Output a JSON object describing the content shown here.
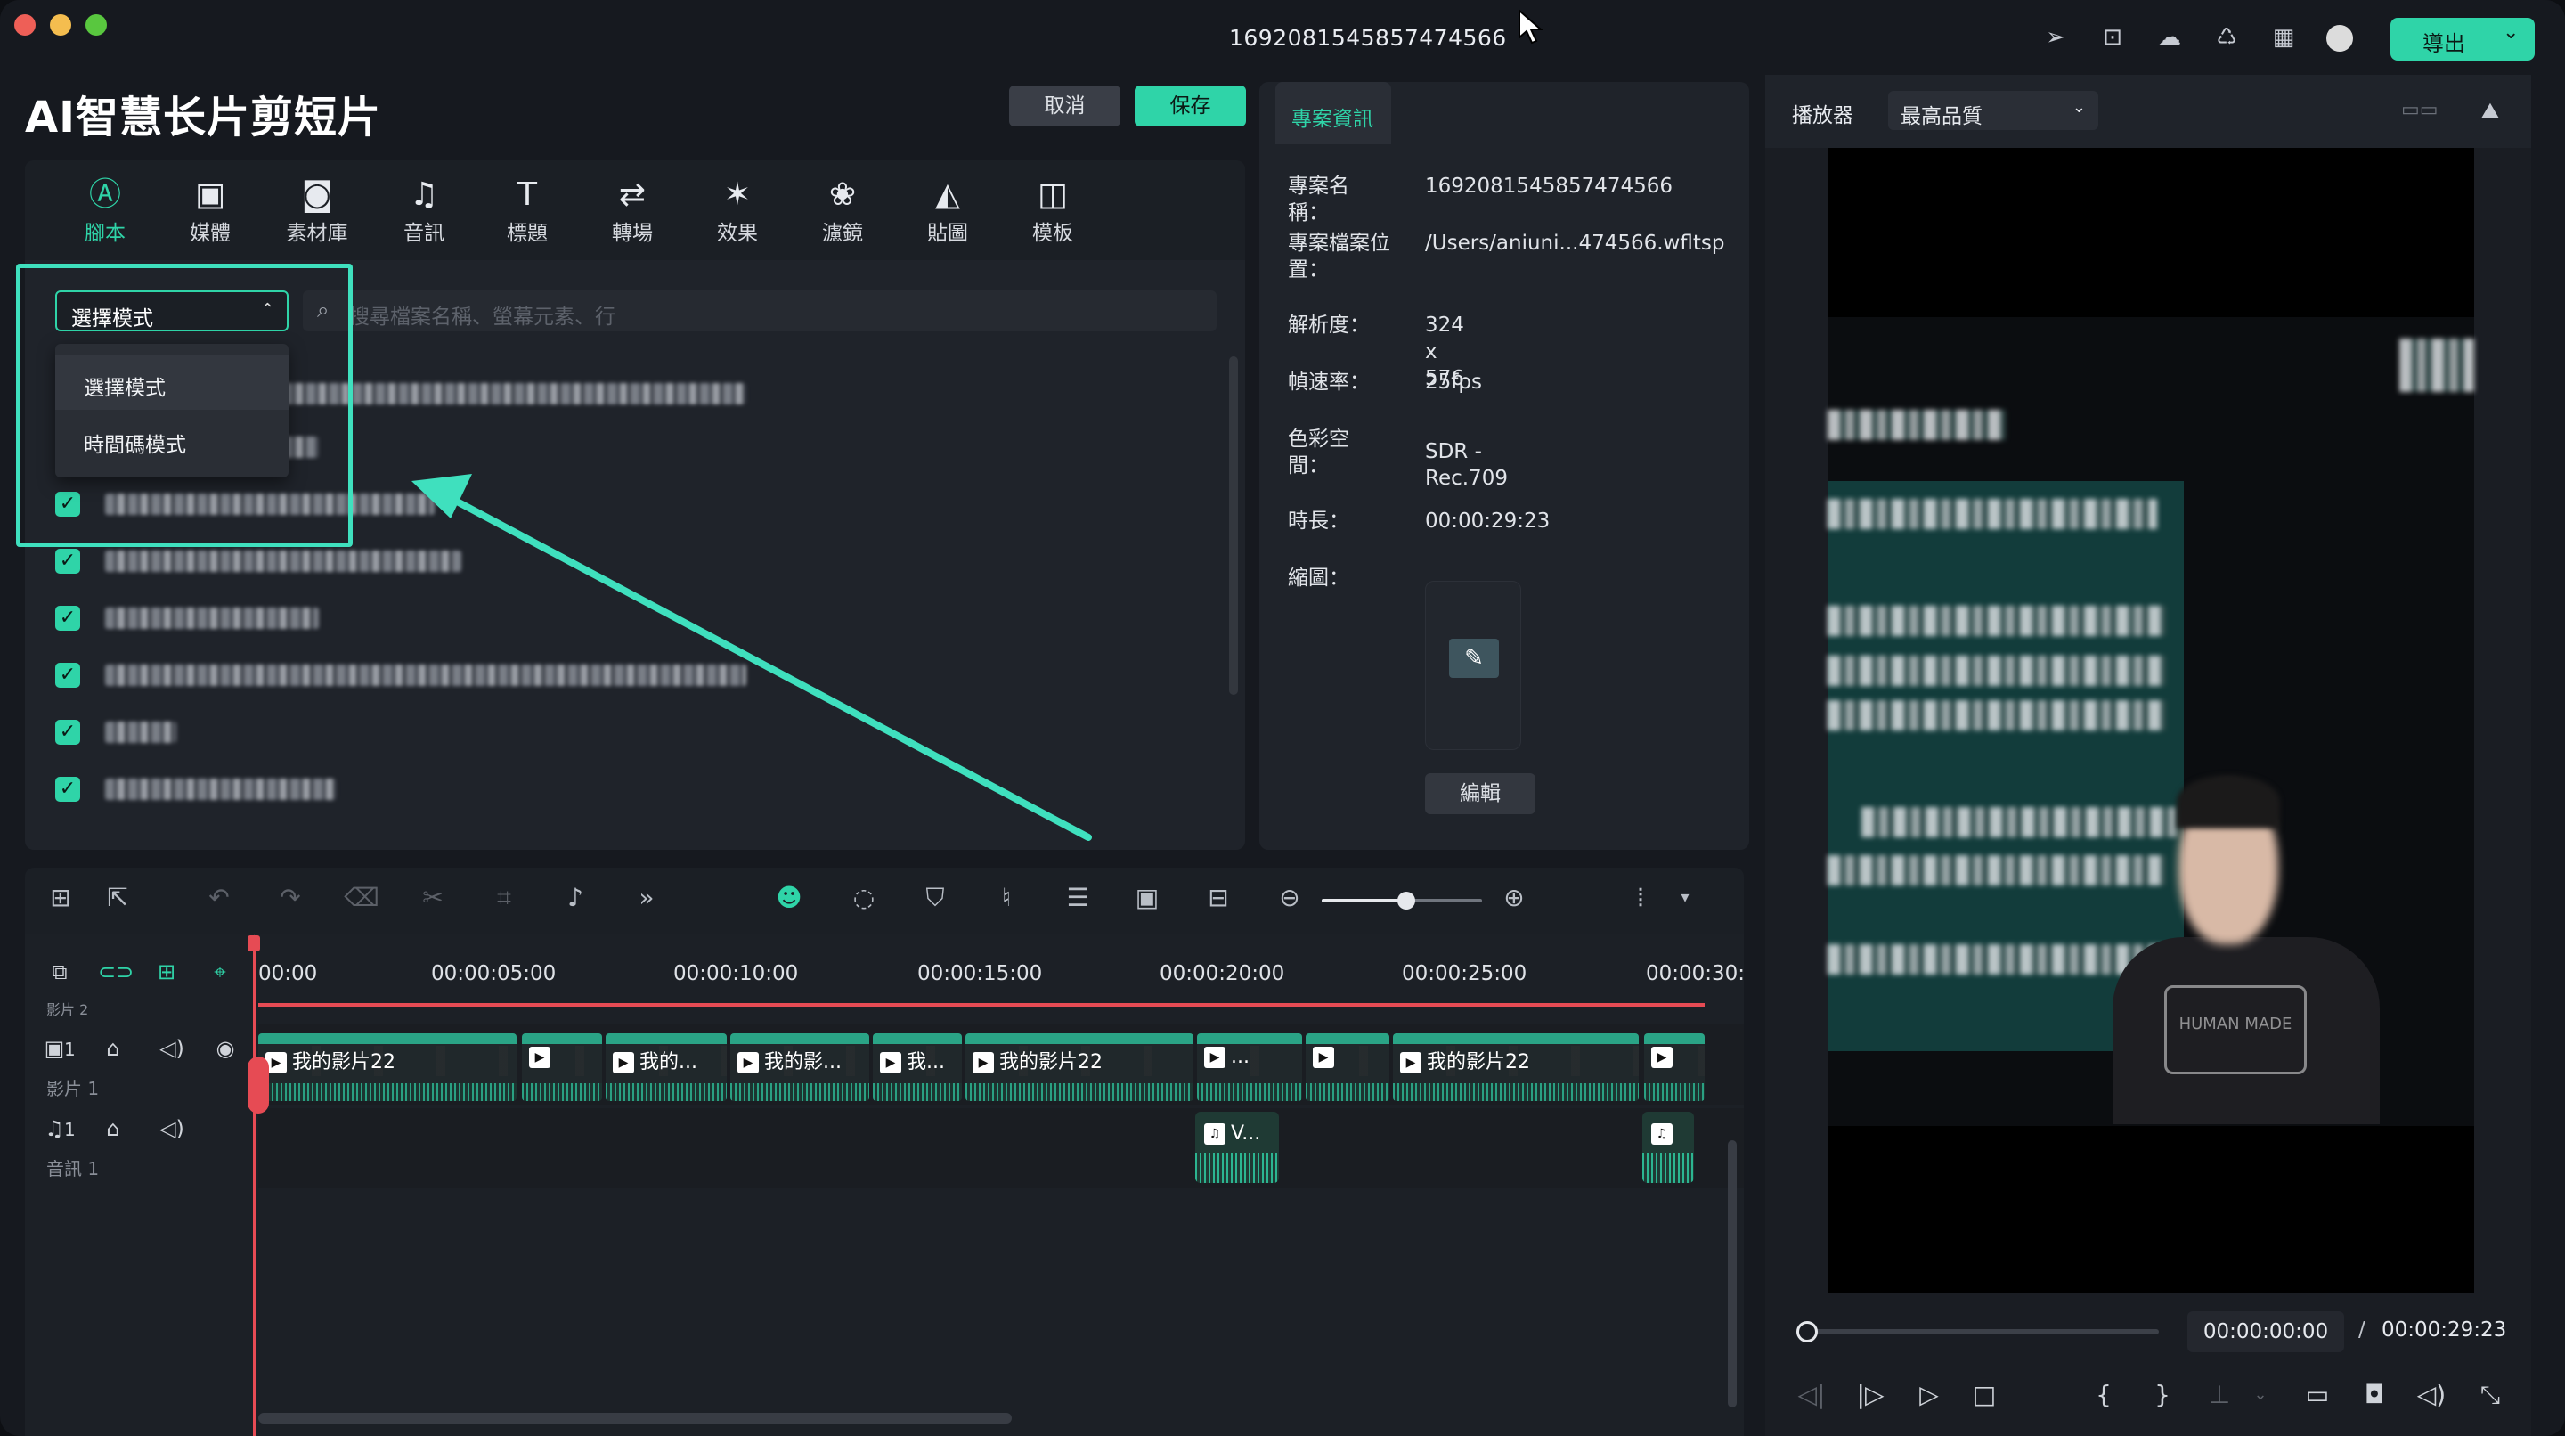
{
  "window": {
    "title": "1692081545857474566",
    "export_label": "導出",
    "export_caret": "⌄",
    "traffic_colors": [
      "#ee5f57",
      "#f4bd4f",
      "#59c73f"
    ],
    "accent": "#2fd4a8"
  },
  "titlebar_icons": [
    "send-icon",
    "feedback-icon",
    "cloud-icon",
    "headset-icon",
    "grid-icon",
    "avatar"
  ],
  "header": {
    "title": "AI智慧长片剪短片",
    "cancel_label": "取消",
    "save_label": "保存"
  },
  "tabs": [
    {
      "label": "腳本",
      "icon": "script-icon",
      "glyph": "Ⓐ",
      "active": true
    },
    {
      "label": "媒體",
      "icon": "media-icon",
      "glyph": "▣"
    },
    {
      "label": "素材庫",
      "icon": "library-icon",
      "glyph": "◙"
    },
    {
      "label": "音訊",
      "icon": "music-icon",
      "glyph": "♫"
    },
    {
      "label": "標題",
      "icon": "title-icon",
      "glyph": "T"
    },
    {
      "label": "轉場",
      "icon": "transition-icon",
      "glyph": "⇄"
    },
    {
      "label": "效果",
      "icon": "effect-icon",
      "glyph": "✶"
    },
    {
      "label": "濾鏡",
      "icon": "filter-icon",
      "glyph": "❀"
    },
    {
      "label": "貼圖",
      "icon": "sticker-icon",
      "glyph": "◭"
    },
    {
      "label": "模板",
      "icon": "template-icon",
      "glyph": "◫"
    }
  ],
  "script_panel": {
    "mode_select_value": "選擇模式",
    "mode_caret": "⌃",
    "search_placeholder": "搜尋檔案名稱、螢幕元素、行",
    "dropdown_options": [
      "選擇模式",
      "時間碼模式"
    ],
    "check_mark": "✓"
  },
  "project_info": {
    "tab_label": "專案資訊",
    "rows": [
      {
        "key": "專案名稱：",
        "value": "1692081545857474566"
      },
      {
        "key": "專案檔案位置：",
        "value": "/Users/aniuni...474566.wfltsp"
      },
      {
        "key": "解析度：",
        "value": "324 x 576"
      },
      {
        "key": "幀速率：",
        "value": "25fps"
      },
      {
        "key": "色彩空間：",
        "value": "SDR - Rec.709"
      },
      {
        "key": "時長：",
        "value": "00:00:29:23"
      },
      {
        "key": "縮圖：",
        "value": ""
      }
    ],
    "edit_label": "編輯",
    "thumb_edit_glyph": "✎"
  },
  "player": {
    "label": "播放器",
    "quality": "最高品質",
    "quality_caret": "⌄",
    "current_time": "00:00:00:00",
    "separator": "/",
    "total_time": "00:00:29:23",
    "progress": 0,
    "tee_print": "HUMAN MADE"
  },
  "timeline": {
    "ruler": [
      "00:00",
      "00:00:05:00",
      "00:00:10:00",
      "00:00:15:00",
      "00:00:20:00",
      "00:00:25:00",
      "00:00:30:"
    ],
    "video_track_label": "影片 1",
    "audio_track_label": "音訊 1",
    "video_track_number": "1",
    "audio_track_number": "1",
    "partial_track_label": "影片 2",
    "video_clips": [
      "我的影片22",
      "",
      "我的...",
      "我的影...",
      "我...",
      "我的影片22",
      "...",
      "",
      "我的影片22",
      ""
    ],
    "audio_clips": [
      "V...",
      ""
    ],
    "zoom_level": 0.53
  }
}
